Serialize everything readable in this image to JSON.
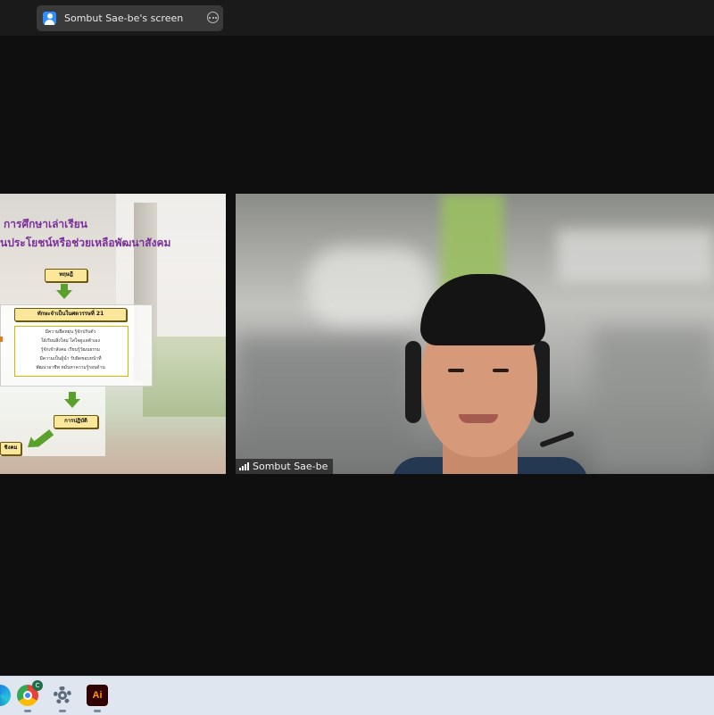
{
  "top_bar": {
    "share_label": "Sombut Sae-be's screen"
  },
  "slide": {
    "title_line1": "การศึกษาเล่าเรียน",
    "title_line2": "นประโยชน์หรือช่วยเหลือพัฒนาสังคม",
    "box_theory": "ทฤษฎี",
    "box_skills": "ทักษะจำเป็นในศตวรรษที่ 21",
    "skill_lines": [
      "มีความยืดหยุ่น รู้จักปรับตัว",
      "ใฝ่เรียนสิ่งใหม่ ใส่ใจดูแลตัวเอง",
      "รู้จักเข้าสังคม เรียนรู้วัฒนธรรม",
      "มีความเป็นผู้นำ รับผิดชอบหน้าที่",
      "พัฒนาอาชีพ หมั่นหาความรู้รอบด้าน"
    ],
    "box_practice": "การปฏิบัติ",
    "box_bottom": "ชิงคม"
  },
  "camera": {
    "participant_name": "Sombut Sae-be"
  },
  "taskbar": {
    "items": [
      {
        "name": "edge-icon"
      },
      {
        "name": "chrome-icon",
        "badge": "C"
      },
      {
        "name": "settings-gear-icon"
      },
      {
        "name": "illustrator-icon",
        "label": "Ai"
      }
    ]
  },
  "colors": {
    "background": "#0f0f0f",
    "top_bar": "#1a1a1a",
    "share_pill": "#3a3a3a",
    "accent_blue": "#2d8cff",
    "slide_title": "#7a2f9a",
    "flow_box": "#fbe79a",
    "arrow_green": "#5aa02c",
    "taskbar": "#dfe6ef"
  }
}
